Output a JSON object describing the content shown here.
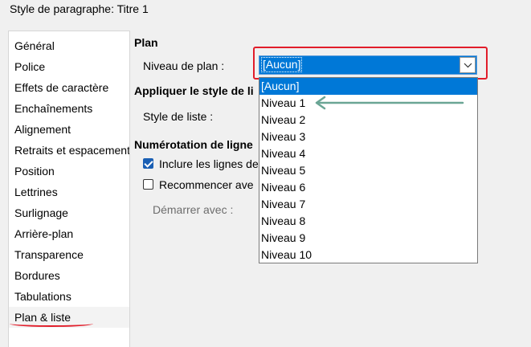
{
  "window": {
    "title": "Style de paragraphe: Titre 1"
  },
  "sidebar": {
    "items": [
      {
        "label": "Général"
      },
      {
        "label": "Police"
      },
      {
        "label": "Effets de caractère"
      },
      {
        "label": "Enchaînements"
      },
      {
        "label": "Alignement"
      },
      {
        "label": "Retraits et espacement"
      },
      {
        "label": "Position"
      },
      {
        "label": "Lettrines"
      },
      {
        "label": "Surlignage"
      },
      {
        "label": "Arrière-plan"
      },
      {
        "label": "Transparence"
      },
      {
        "label": "Bordures"
      },
      {
        "label": "Tabulations"
      },
      {
        "label": "Plan & liste"
      }
    ],
    "active_index": 13
  },
  "plan": {
    "heading": "Plan",
    "level_label": "Niveau de plan :",
    "level_value": "[Aucun]",
    "level_options": [
      "[Aucun]",
      "Niveau 1",
      "Niveau 2",
      "Niveau 3",
      "Niveau 4",
      "Niveau 5",
      "Niveau 6",
      "Niveau 7",
      "Niveau 8",
      "Niveau 9",
      "Niveau 10"
    ],
    "selected_option_index": 0
  },
  "list_style": {
    "heading": "Appliquer le style de li",
    "label": "Style de liste :"
  },
  "numbering": {
    "heading": "Numérotation de ligne",
    "include_label": "Inclure les lignes de",
    "include_checked": true,
    "restart_label": "Recommencer ave",
    "restart_checked": false,
    "start_label": "Démarrer avec :"
  },
  "colors": {
    "highlight": "#0078d7",
    "annotation_red": "#e11d2a",
    "annotation_arrow": "#6aa595"
  }
}
